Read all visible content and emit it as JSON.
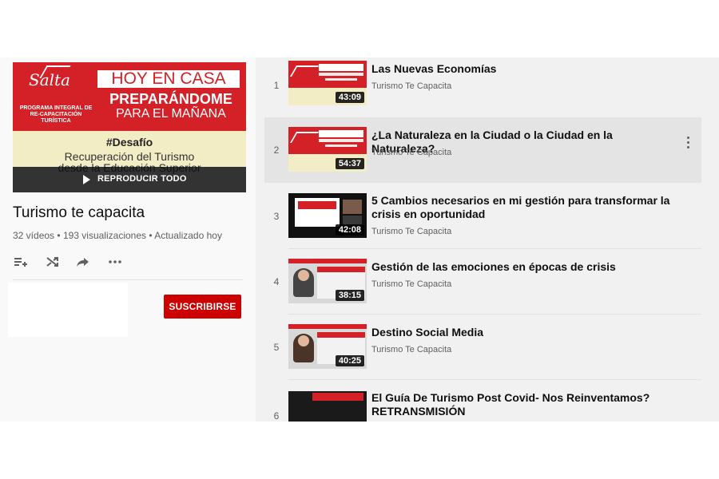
{
  "colors": {
    "brand_red": "#d42128",
    "subscribe_red": "#cc0000",
    "cream": "#f3edc6"
  },
  "playlist": {
    "banner": {
      "logo": "Salta",
      "program": "PROGRAMA INTEGRAL DE RE-CAPACITACIÓN TURÍSTICA",
      "line1": "HOY EN CASA",
      "line2": "PREPARÁNDOME",
      "line3": "PARA EL MAÑANA",
      "hashtag": "#Desafío",
      "subtitle1": "Recuperación del Turismo",
      "subtitle2": "desde la Educación Superior"
    },
    "play_all": "REPRODUCIR TODO",
    "title": "Turismo te capacita",
    "video_count": "32 vídeos",
    "views": "193 visualizaciones",
    "updated": "Actualizado hoy",
    "meta_sep": "•",
    "actions": [
      "add-to-queue-icon",
      "shuffle-icon",
      "share-icon",
      "more-icon"
    ],
    "subscribe": "SUSCRIBIRSE"
  },
  "videos": [
    {
      "index": "1",
      "title": "Las Nuevas Economías",
      "channel": "Turismo Te Capacita",
      "duration": "43:09"
    },
    {
      "index": "2",
      "title": "¿La Naturaleza en la Ciudad o la Ciudad en la Naturaleza?",
      "channel": "Turismo Te Capacita",
      "duration": "54:37"
    },
    {
      "index": "3",
      "title": "5 Cambios necesarios en mi gestión para transformar la crisis en oportunidad",
      "channel": "Turismo Te Capacita",
      "duration": "42:08"
    },
    {
      "index": "4",
      "title": "Gestión de las emociones en épocas de crisis",
      "channel": "Turismo Te Capacita",
      "duration": "38:15"
    },
    {
      "index": "5",
      "title": "Destino Social Media",
      "channel": "Turismo Te Capacita",
      "duration": "40:25"
    },
    {
      "index": "6",
      "title": "El Guía De Turismo Post Covid- Nos Reinventamos? RETRANSMISIÓN",
      "channel": "",
      "duration": ""
    }
  ]
}
